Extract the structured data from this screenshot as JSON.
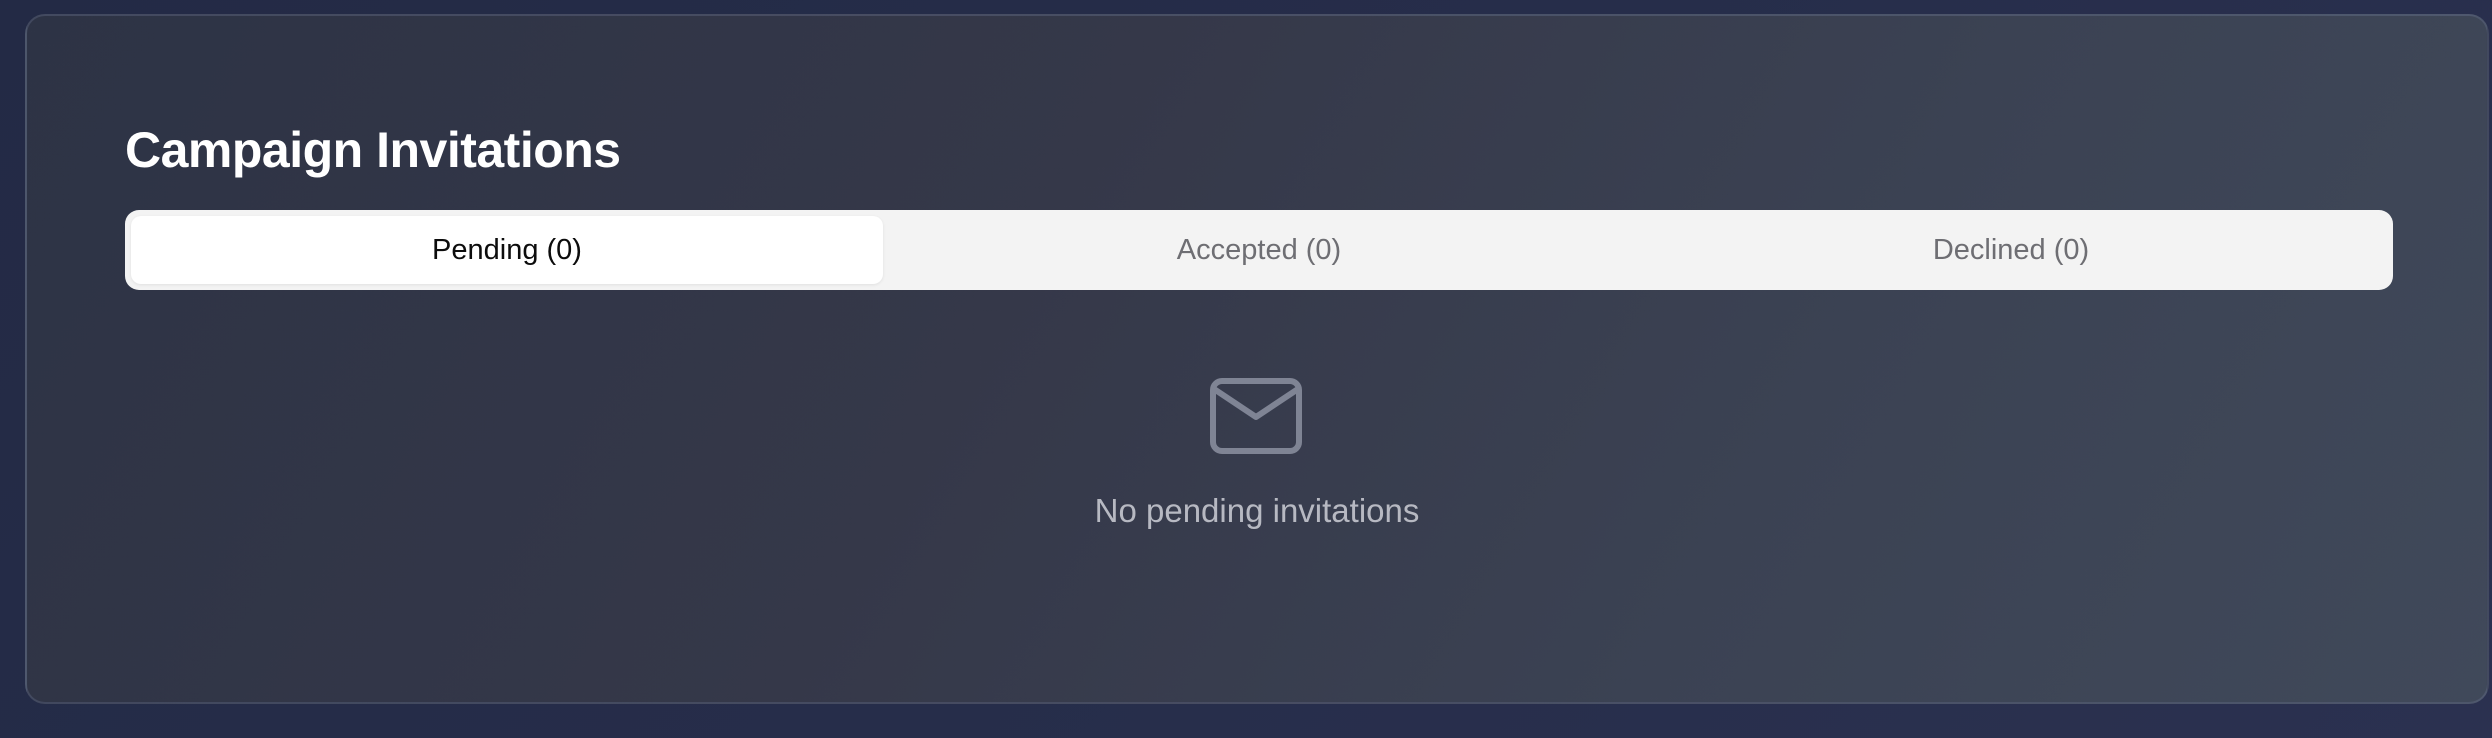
{
  "card": {
    "title": "Campaign Invitations"
  },
  "tabs": [
    {
      "label": "Pending (0)",
      "active": true
    },
    {
      "label": "Accepted (0)",
      "active": false
    },
    {
      "label": "Declined (0)",
      "active": false
    }
  ],
  "empty_state": {
    "icon": "mail-icon",
    "message": "No pending invitations"
  },
  "colors": {
    "background": "#262d4a",
    "panel": "#363a4c",
    "tab_bar": "#f3f3f3",
    "active_tab": "#ffffff",
    "icon": "#7f8494"
  }
}
